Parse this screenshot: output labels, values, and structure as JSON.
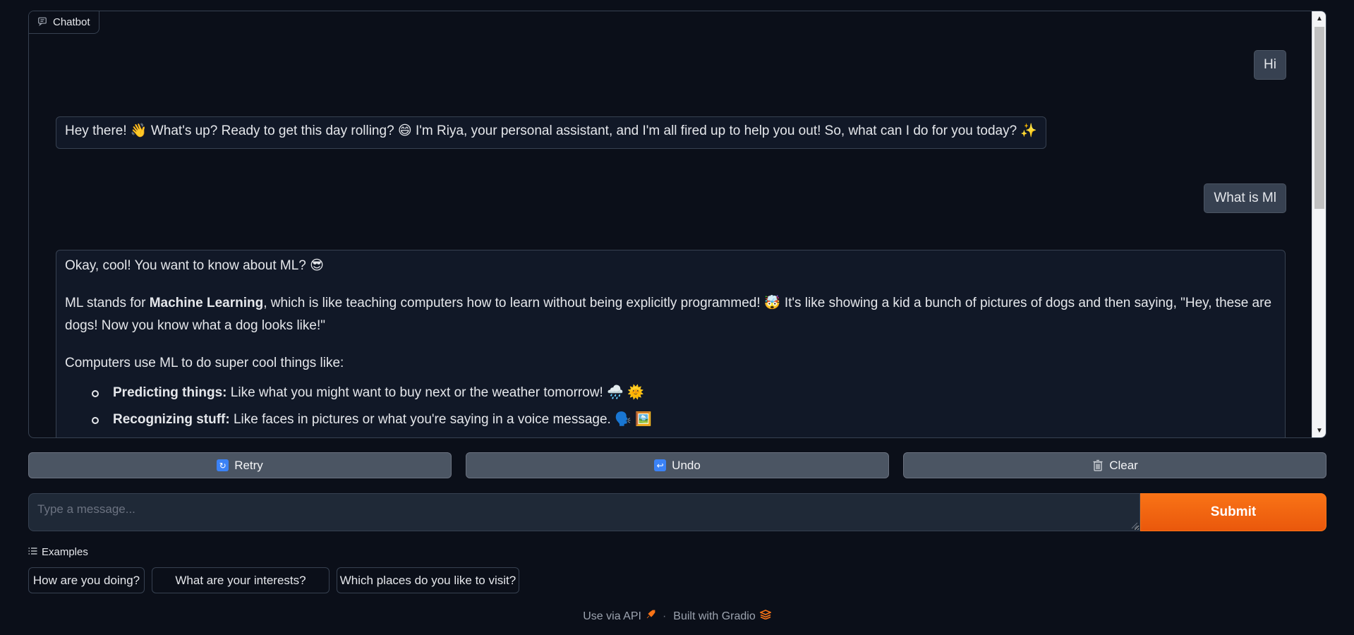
{
  "chatbot": {
    "label": "Chatbot",
    "messages": [
      {
        "role": "user",
        "text": "Hi"
      },
      {
        "role": "bot",
        "text": "Hey there! 👋 What's up? Ready to get this day rolling? 😄 I'm Riya, your personal assistant, and I'm all fired up to help you out! So, what can I do for you today? ✨"
      },
      {
        "role": "user",
        "text": "What is Ml"
      },
      {
        "role": "bot",
        "para1": "Okay, cool! You want to know about ML? 😎",
        "para2_prefix": "ML stands for ",
        "para2_bold": "Machine Learning",
        "para2_suffix": ", which is like teaching computers how to learn without being explicitly programmed! 🤯 It's like showing a kid a bunch of pictures of dogs and then saying, \"Hey, these are dogs! Now you know what a dog looks like!\"",
        "para3": "Computers use ML to do super cool things like:",
        "bullets": [
          {
            "bold": "Predicting things:",
            "text": " Like what you might want to buy next or the weather tomorrow! 🌧️ 🌞"
          },
          {
            "bold": "Recognizing stuff:",
            "text": " Like faces in pictures or what you're saying in a voice message. 🗣️ 🖼️"
          }
        ]
      }
    ]
  },
  "actions": {
    "retry": "Retry",
    "undo": "Undo",
    "clear": "Clear"
  },
  "input": {
    "placeholder": "Type a message...",
    "submit": "Submit"
  },
  "examples": {
    "label": "Examples",
    "items": [
      "How are you doing?",
      "What are your interests?",
      "Which places do you like to visit?"
    ]
  },
  "footer": {
    "api": "Use via API",
    "separator": "·",
    "built": "Built with Gradio"
  },
  "colors": {
    "background": "#0b0f19",
    "accent": "#f97316",
    "button": "#4b5563"
  }
}
